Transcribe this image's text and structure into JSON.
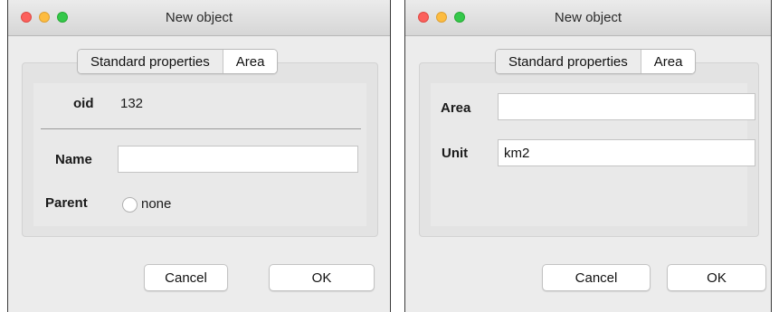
{
  "windows": [
    {
      "title": "New object",
      "tabs": [
        "Standard properties",
        "Area"
      ],
      "selected_tab": "Standard properties",
      "fields": {
        "oid_label": "oid",
        "oid_value": "132",
        "name_label": "Name",
        "name_value": "",
        "parent_label": "Parent",
        "parent_option": "none"
      },
      "buttons": {
        "cancel": "Cancel",
        "ok": "OK"
      }
    },
    {
      "title": "New object",
      "tabs": [
        "Standard properties",
        "Area"
      ],
      "selected_tab": "Standard properties",
      "fields": {
        "area_label": "Area",
        "area_value": "",
        "unit_label": "Unit",
        "unit_value": "km2"
      },
      "buttons": {
        "cancel": "Cancel",
        "ok": "OK"
      }
    }
  ],
  "colors": {
    "close": "#fc605c",
    "minimize": "#fdbc40",
    "zoom": "#34c84a",
    "window_bg": "#ececec"
  }
}
